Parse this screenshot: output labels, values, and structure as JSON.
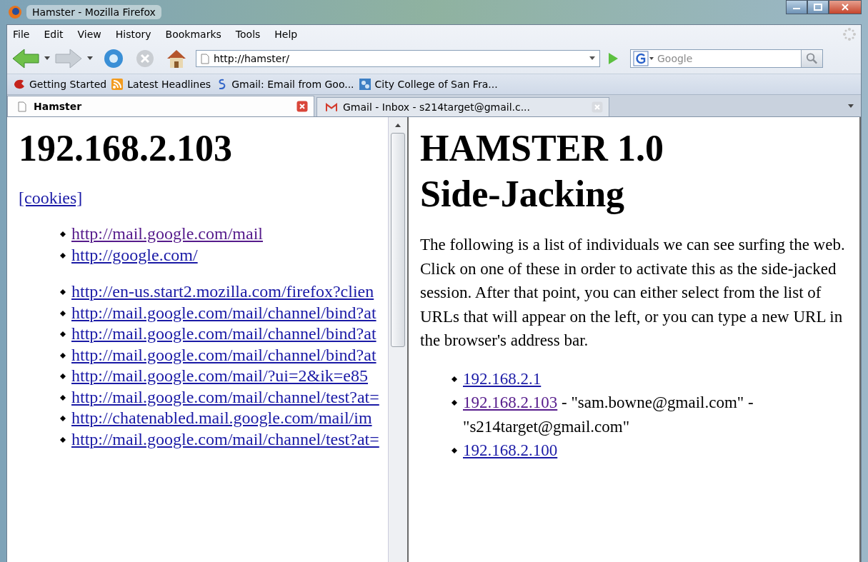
{
  "window": {
    "title": "Hamster - Mozilla Firefox"
  },
  "menu": [
    "File",
    "Edit",
    "View",
    "History",
    "Bookmarks",
    "Tools",
    "Help"
  ],
  "address": {
    "value": "http://hamster/"
  },
  "search": {
    "placeholder": "Google"
  },
  "bookmarks": [
    {
      "label": "Getting Started",
      "kind": "star"
    },
    {
      "label": "Latest Headlines",
      "kind": "feed"
    },
    {
      "label": "Gmail: Email from Goo...",
      "kind": "g"
    },
    {
      "label": "City College of San Fra...",
      "kind": "college"
    }
  ],
  "tabs": [
    {
      "label": "Hamster",
      "selected": true,
      "kind": "page"
    },
    {
      "label": "Gmail - Inbox - s214target@gmail.c...",
      "selected": false,
      "kind": "mail"
    }
  ],
  "left_frame": {
    "heading": "192.168.2.103",
    "cookies_link": "[cookies]",
    "link_groups": [
      [
        {
          "url": "http://mail.google.com/mail",
          "visited": true
        },
        {
          "url": "http://google.com/",
          "visited": false
        }
      ],
      [
        {
          "url": "http://en-us.start2.mozilla.com/firefox?clien",
          "visited": false
        },
        {
          "url": "http://mail.google.com/mail/channel/bind?at",
          "visited": false
        },
        {
          "url": "http://mail.google.com/mail/channel/bind?at",
          "visited": false
        },
        {
          "url": "http://mail.google.com/mail/channel/bind?at",
          "visited": false
        },
        {
          "url": "http://mail.google.com/mail/?ui=2&ik=e85",
          "visited": false
        },
        {
          "url": "http://mail.google.com/mail/channel/test?at=",
          "visited": false
        },
        {
          "url": "http://chatenabled.mail.google.com/mail/im",
          "visited": false
        },
        {
          "url": "http://mail.google.com/mail/channel/test?at=",
          "visited": false
        }
      ]
    ]
  },
  "right_frame": {
    "heading_lines": [
      "HAMSTER 1.0",
      "Side-Jacking"
    ],
    "intro": "The following is a list of individuals we can see surfing the web. Click on one of these in order to activate this as the side-jacked session. After that point, you can either select from the list of URLs that will appear on the left, or you can type a new URL in the browser's address bar.",
    "hosts": [
      {
        "ip": "192.168.2.1",
        "visited": false
      },
      {
        "ip": "192.168.2.103",
        "visited": true,
        "detail": " - \"sam.bowne@gmail.com\" - \"s214target@gmail.com\""
      },
      {
        "ip": "192.168.2.100",
        "visited": false
      }
    ]
  }
}
